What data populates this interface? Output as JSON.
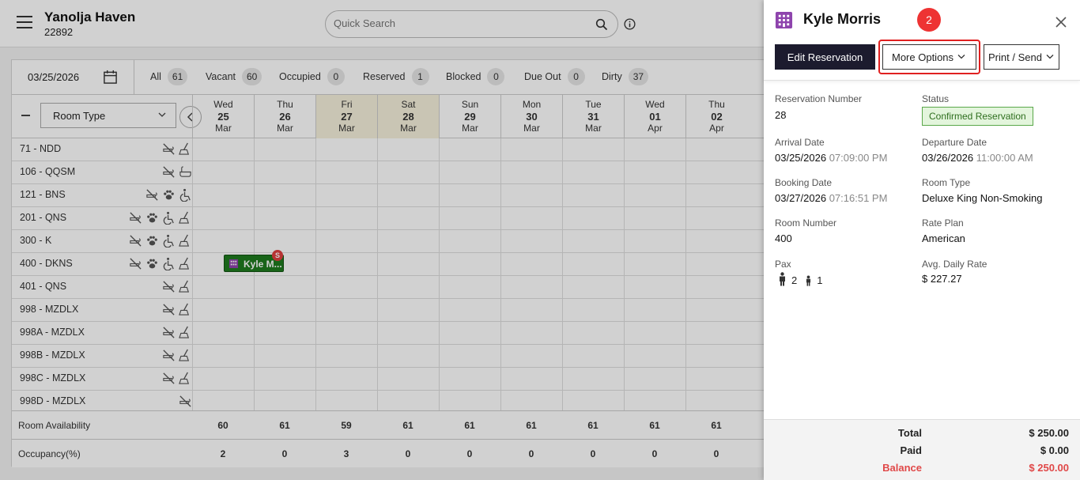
{
  "header": {
    "hotel_name": "Yanolja Haven",
    "hotel_id": "22892",
    "search_placeholder": "Quick Search"
  },
  "filters": {
    "date": "03/25/2026",
    "items": [
      {
        "label": "All",
        "count": "61"
      },
      {
        "label": "Vacant",
        "count": "60"
      },
      {
        "label": "Occupied",
        "count": "0"
      },
      {
        "label": "Reserved",
        "count": "1"
      },
      {
        "label": "Blocked",
        "count": "0"
      },
      {
        "label": "Due Out",
        "count": "0"
      },
      {
        "label": "Dirty",
        "count": "37"
      }
    ]
  },
  "grid": {
    "room_type_label": "Room Type",
    "days": [
      {
        "dow": "Wed",
        "num": "25",
        "mon": "Mar",
        "weekend": false
      },
      {
        "dow": "Thu",
        "num": "26",
        "mon": "Mar",
        "weekend": false
      },
      {
        "dow": "Fri",
        "num": "27",
        "mon": "Mar",
        "weekend": true
      },
      {
        "dow": "Sat",
        "num": "28",
        "mon": "Mar",
        "weekend": true
      },
      {
        "dow": "Sun",
        "num": "29",
        "mon": "Mar",
        "weekend": false
      },
      {
        "dow": "Mon",
        "num": "30",
        "mon": "Mar",
        "weekend": false
      },
      {
        "dow": "Tue",
        "num": "31",
        "mon": "Mar",
        "weekend": false
      },
      {
        "dow": "Wed",
        "num": "01",
        "mon": "Apr",
        "weekend": false
      },
      {
        "dow": "Thu",
        "num": "02",
        "mon": "Apr",
        "weekend": false
      }
    ],
    "rooms": [
      {
        "name": "71 - NDD",
        "icons": [
          "no-smoking-icon",
          "housekeeping-icon"
        ]
      },
      {
        "name": "106 - QQSM",
        "icons": [
          "no-smoking-icon",
          "bathtub-icon"
        ]
      },
      {
        "name": "121 - BNS",
        "icons": [
          "no-smoking-icon",
          "pet-icon",
          "wheelchair-icon"
        ]
      },
      {
        "name": "201 - QNS",
        "icons": [
          "no-smoking-icon",
          "pet-icon",
          "wheelchair-icon",
          "housekeeping-icon"
        ]
      },
      {
        "name": "300 - K",
        "icons": [
          "no-smoking-icon",
          "pet-icon",
          "wheelchair-icon",
          "housekeeping-icon"
        ]
      },
      {
        "name": "400 - DKNS",
        "icons": [
          "no-smoking-icon",
          "pet-icon",
          "wheelchair-icon",
          "housekeeping-icon"
        ]
      },
      {
        "name": "401 - QNS",
        "icons": [
          "no-smoking-icon",
          "housekeeping-icon"
        ]
      },
      {
        "name": "998 - MZDLX",
        "icons": [
          "no-smoking-icon",
          "housekeeping-icon"
        ]
      },
      {
        "name": "998A - MZDLX",
        "icons": [
          "no-smoking-icon",
          "housekeeping-icon"
        ]
      },
      {
        "name": "998B - MZDLX",
        "icons": [
          "no-smoking-icon",
          "housekeeping-icon"
        ]
      },
      {
        "name": "998C - MZDLX",
        "icons": [
          "no-smoking-icon",
          "housekeeping-icon"
        ]
      },
      {
        "name": "998D - MZDLX",
        "icons": [
          "no-smoking-icon"
        ]
      }
    ],
    "reservation_chip": {
      "label": "Kyle M...",
      "badge": "S"
    },
    "availability": {
      "label": "Room Availability",
      "values": [
        "60",
        "61",
        "59",
        "61",
        "61",
        "61",
        "61",
        "61",
        "61"
      ]
    },
    "occupancy": {
      "label": "Occupancy(%)",
      "values": [
        "2",
        "0",
        "3",
        "0",
        "0",
        "0",
        "0",
        "0",
        "0"
      ]
    }
  },
  "panel": {
    "guest_name": "Kyle Morris",
    "step_badge": "2",
    "edit_label": "Edit Reservation",
    "more_label": "More Options",
    "print_label": "Print / Send",
    "fields": {
      "reservation_number_label": "Reservation Number",
      "reservation_number": "28",
      "status_label": "Status",
      "status": "Confirmed Reservation",
      "arrival_label": "Arrival Date",
      "arrival_date": "03/25/2026",
      "arrival_time": "07:09:00 PM",
      "departure_label": "Departure Date",
      "departure_date": "03/26/2026",
      "departure_time": "11:00:00 AM",
      "booking_label": "Booking Date",
      "booking_date": "03/27/2026",
      "booking_time": "07:16:51 PM",
      "room_type_label": "Room Type",
      "room_type": "Deluxe King Non-Smoking",
      "room_number_label": "Room Number",
      "room_number": "400",
      "rate_plan_label": "Rate Plan",
      "rate_plan": "American",
      "pax_label": "Pax",
      "adults": "2",
      "children": "1",
      "adr_label": "Avg. Daily Rate",
      "adr": "$ 227.27"
    },
    "totals": {
      "total_label": "Total",
      "total": "$ 250.00",
      "paid_label": "Paid",
      "paid": "$ 0.00",
      "balance_label": "Balance",
      "balance": "$ 250.00"
    }
  },
  "colors": {
    "status_green": "#5aa84a",
    "chip_green": "#1e7a1e",
    "balance_red": "#e04848",
    "primary_dark": "#1c1b2e",
    "highlight_red": "#e02020"
  }
}
